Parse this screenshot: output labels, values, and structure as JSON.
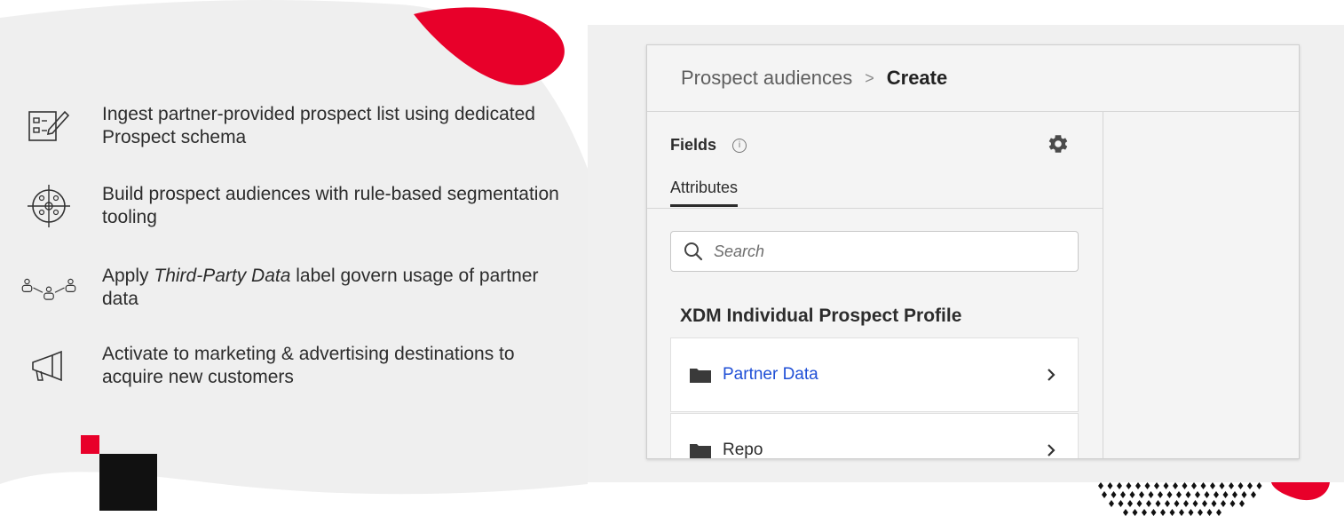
{
  "features": [
    {
      "icon": "checklist-edit-icon",
      "parts": [
        {
          "text": "Ingest partner-provided prospect list using dedicated Prospect schema",
          "italic": false
        }
      ]
    },
    {
      "icon": "target-audience-icon",
      "parts": [
        {
          "text": "Build prospect audiences with rule-based segmentation tooling",
          "italic": false
        }
      ]
    },
    {
      "icon": "people-network-icon",
      "parts": [
        {
          "text": "Apply ",
          "italic": false
        },
        {
          "text": "Third-Party Data",
          "italic": true
        },
        {
          "text": " label govern usage of partner data",
          "italic": false
        }
      ]
    },
    {
      "icon": "megaphone-icon",
      "parts": [
        {
          "text": "Activate to marketing & advertising destinations to acquire new customers",
          "italic": false
        }
      ]
    }
  ],
  "panel": {
    "breadcrumb": {
      "parent": "Prospect audiences",
      "separator": ">",
      "current": "Create"
    },
    "fields_title": "Fields",
    "info_icon": "info-icon",
    "settings_icon": "gear-icon",
    "tab": "Attributes",
    "search": {
      "placeholder": "Search",
      "value": ""
    },
    "section_title": "XDM Individual Prospect Profile",
    "items": [
      {
        "label": "Partner Data",
        "icon": "folder-icon",
        "style": "link"
      },
      {
        "label": "Repo",
        "icon": "folder-icon",
        "style": "plain"
      }
    ]
  },
  "colors": {
    "accent_red": "#e8002a",
    "link_blue": "#1f4fd6",
    "background_gray": "#f0f0f0",
    "panel_bg": "#f4f4f4"
  }
}
